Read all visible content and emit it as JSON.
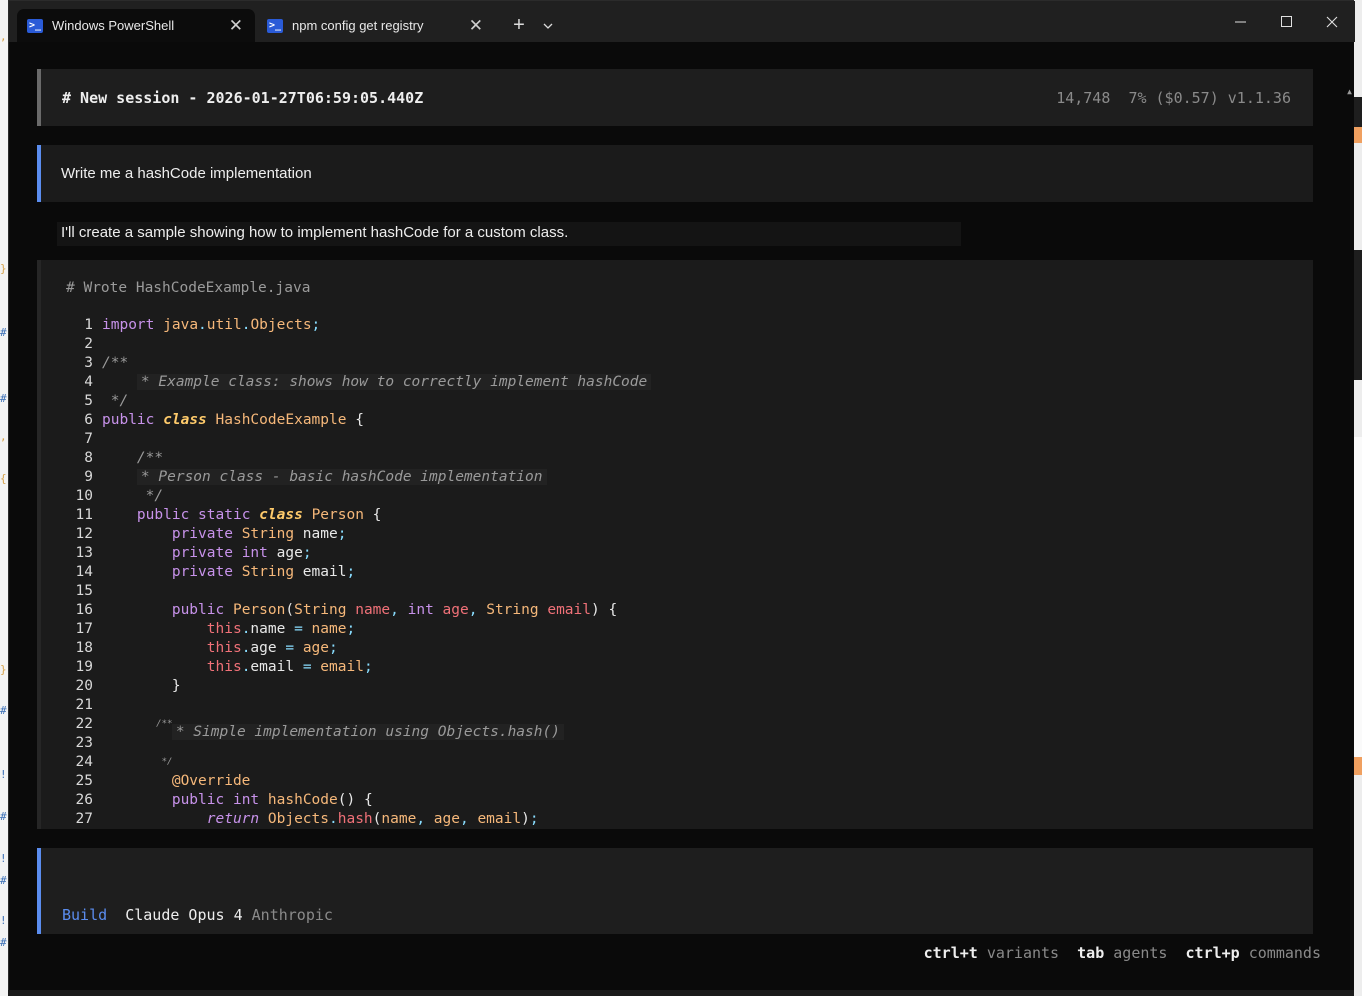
{
  "tabs": [
    {
      "label": "Windows PowerShell",
      "active": true,
      "icon": "powershell-icon"
    },
    {
      "label": "npm config get registry",
      "active": false,
      "icon": "powershell-icon"
    }
  ],
  "session": {
    "title": "# New session - 2026-01-27T06:59:05.440Z",
    "tokens": "14,748",
    "usage": "7% ($0.57)",
    "version": "v1.1.36"
  },
  "user_message": "Write me a hashCode implementation",
  "assistant_message": "I'll create a sample showing how to implement hashCode for a custom class.",
  "code_block": {
    "title": "# Wrote HashCodeExample.java",
    "line_numbers": [
      "1",
      "2",
      "3",
      "4",
      "5",
      "6",
      "7",
      "8",
      "9",
      "10",
      "11",
      "12",
      "13",
      "14",
      "15",
      "16",
      "17",
      "18",
      "19",
      "20",
      "21",
      "22",
      "23",
      "24",
      "25",
      "26",
      "27"
    ]
  },
  "footer": {
    "agent": "Build",
    "model": "Claude Opus 4",
    "provider": "Anthropic"
  },
  "hints": [
    {
      "key": "ctrl+t",
      "label": "variants"
    },
    {
      "key": "tab",
      "label": "agents"
    },
    {
      "key": "ctrl+p",
      "label": "commands"
    }
  ],
  "colors": {
    "accent_blue": "#5b8def",
    "background": "#0a0a0a",
    "panel": "#1b1b1b"
  }
}
